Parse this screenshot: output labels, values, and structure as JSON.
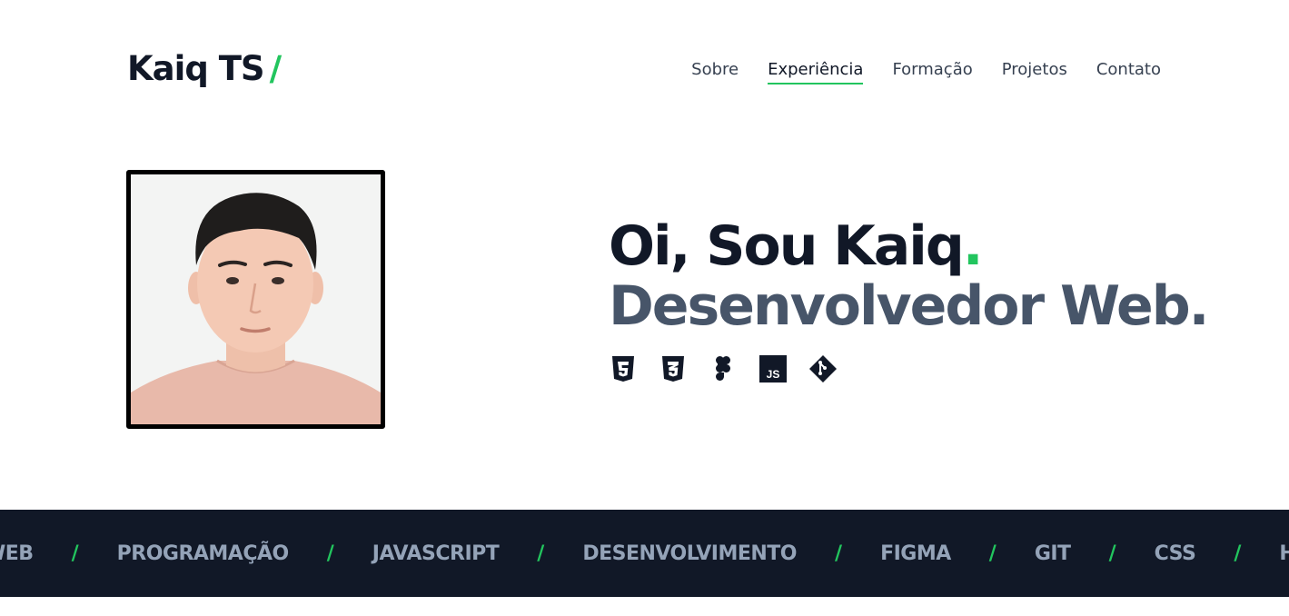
{
  "header": {
    "logo_text": "Kaiq TS",
    "logo_slash": "/",
    "nav": [
      {
        "label": "Sobre"
      },
      {
        "label": "Experiência"
      },
      {
        "label": "Formação"
      },
      {
        "label": "Projetos"
      },
      {
        "label": "Contato"
      }
    ],
    "active_nav": "Experiência"
  },
  "hero": {
    "greeting": "Oi, Sou Kaiq",
    "greeting_dot": ".",
    "role": "Desenvolvedor Web.",
    "tech_icons": [
      "html5-icon",
      "css3-icon",
      "figma-icon",
      "javascript-icon",
      "git-icon"
    ],
    "js_label": "JS"
  },
  "band": {
    "items": [
      "WEB",
      "PROGRAMAÇÃO",
      "JAVASCRIPT",
      "DESENVOLVIMENTO",
      "FIGMA",
      "GIT",
      "CSS",
      "HTML"
    ],
    "separator": "/"
  },
  "colors": {
    "accent": "#22c55e",
    "dark": "#111827",
    "band_text": "#94a3b8",
    "subtitle": "#475569"
  }
}
